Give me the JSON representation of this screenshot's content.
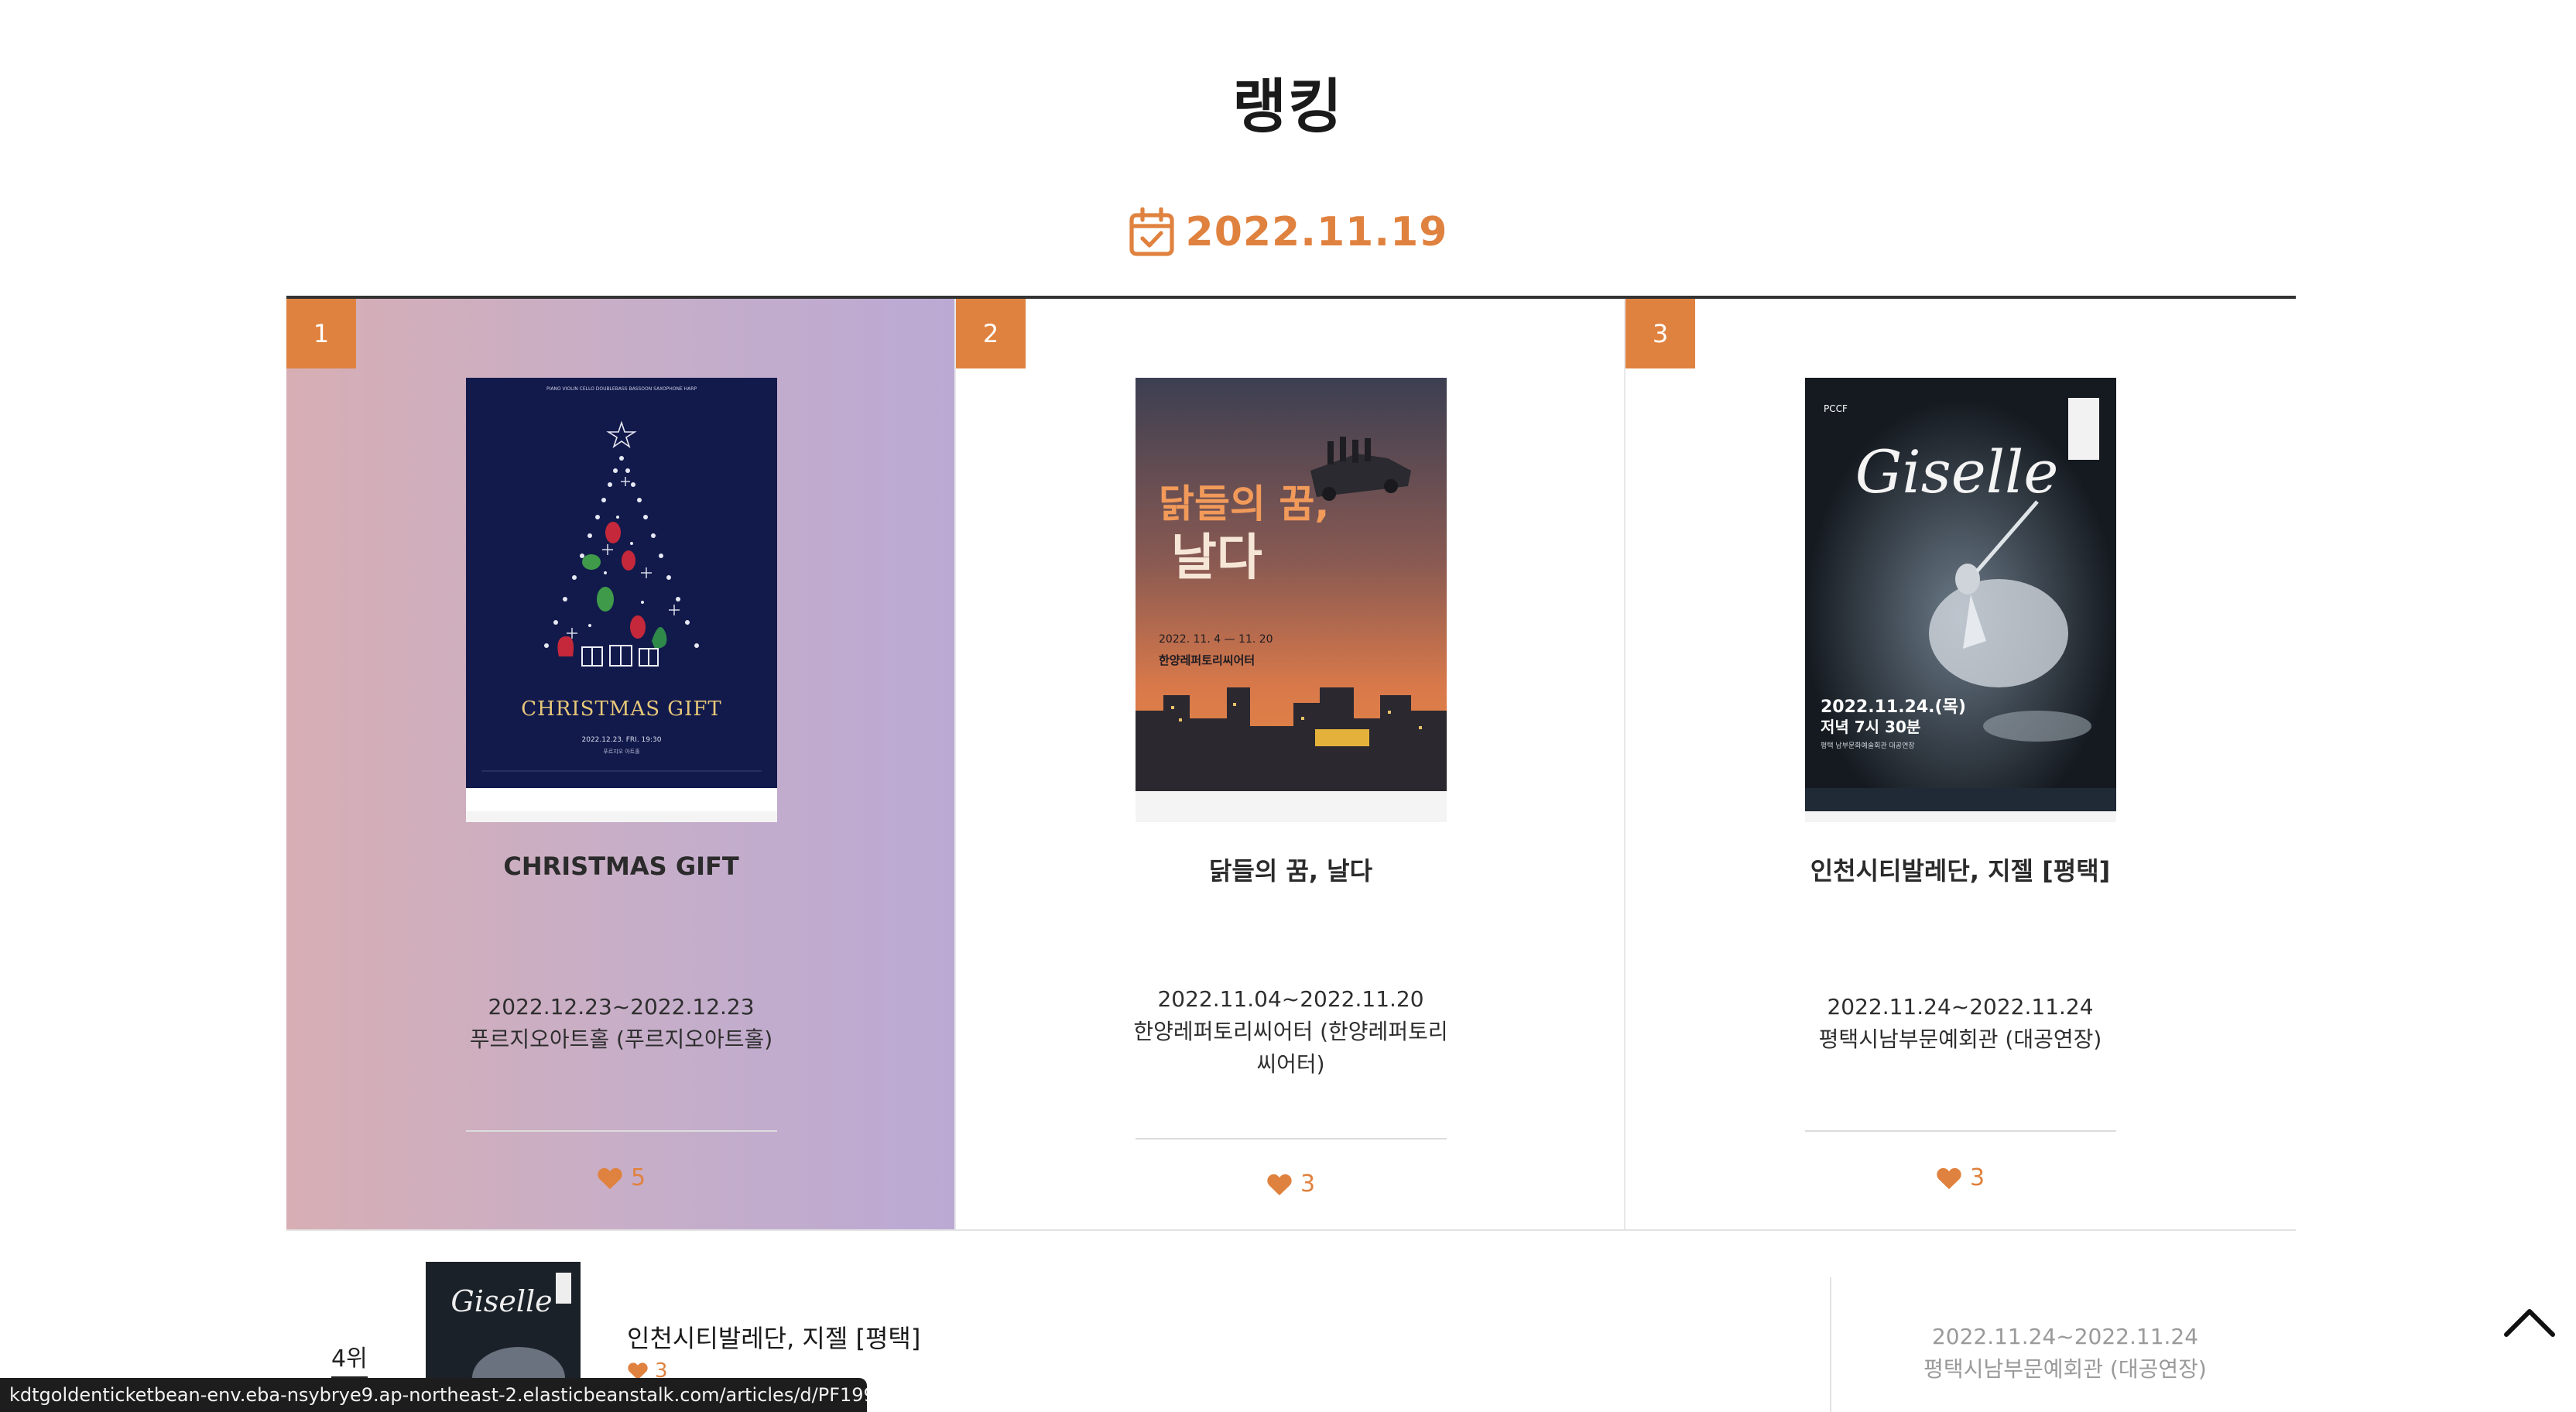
{
  "page": {
    "title": "랭킹"
  },
  "date_selector": {
    "icon": "calendar-check-icon",
    "date": "2022.11.19"
  },
  "top_ranks": [
    {
      "rank": "1",
      "title": "CHRISTMAS GIFT",
      "period": "2022.12.23~2022.12.23",
      "venue": "푸르지오아트홀 (푸르지오아트홀)",
      "likes": "5",
      "poster": {
        "top_line": "PIANO VIOLIN CELLO DOUBLEBASS BASSOON SAXOPHONE HARP",
        "headline": "CHRISTMAS GIFT",
        "date_line": "2022.12.23. FRI. 19:30",
        "venue_line": "푸르지오 아트홀"
      }
    },
    {
      "rank": "2",
      "title": "닭들의 꿈, 날다",
      "period": "2022.11.04~2022.11.20",
      "venue": "한양레퍼토리씨어터 (한양레퍼토리씨어터)",
      "likes": "3",
      "poster": {
        "headline_top": "닭들의 꿈,",
        "headline_bottom": "날다",
        "date_line": "2022. 11. 4 — 11. 20",
        "venue_line": "한양레퍼토리씨어터"
      }
    },
    {
      "rank": "3",
      "title": "인천시티발레단, 지젤 [평택]",
      "period": "2022.11.24~2022.11.24",
      "venue": "평택시남부문예회관 (대공연장)",
      "likes": "3",
      "poster": {
        "logo": "PCCF",
        "headline": "Giselle",
        "date_line": "2022.11.24.(목)",
        "time_line": "저녁 7시 30분",
        "venue_line": "평택 남부문화예술회관 대공연장"
      }
    }
  ],
  "list_ranks": [
    {
      "rank": "4위",
      "title": "인천시티발레단, 지젤 [평택]",
      "likes": "3",
      "period": "2022.11.24~2022.11.24",
      "venue": "평택시남부문예회관 (대공연장)",
      "poster_headline": "Giselle"
    }
  ],
  "scroll_top": {
    "icon": "chevron-up-icon"
  },
  "status_bar": {
    "url": "kdtgoldenticketbean-env.eba-nsybrye9.ap-northeast-2.elasticbeanstalk.com/articles/d/PF199..."
  },
  "colors": {
    "accent": "#e0823f",
    "divider": "#333333",
    "status_bg": "#1d1d1d"
  }
}
